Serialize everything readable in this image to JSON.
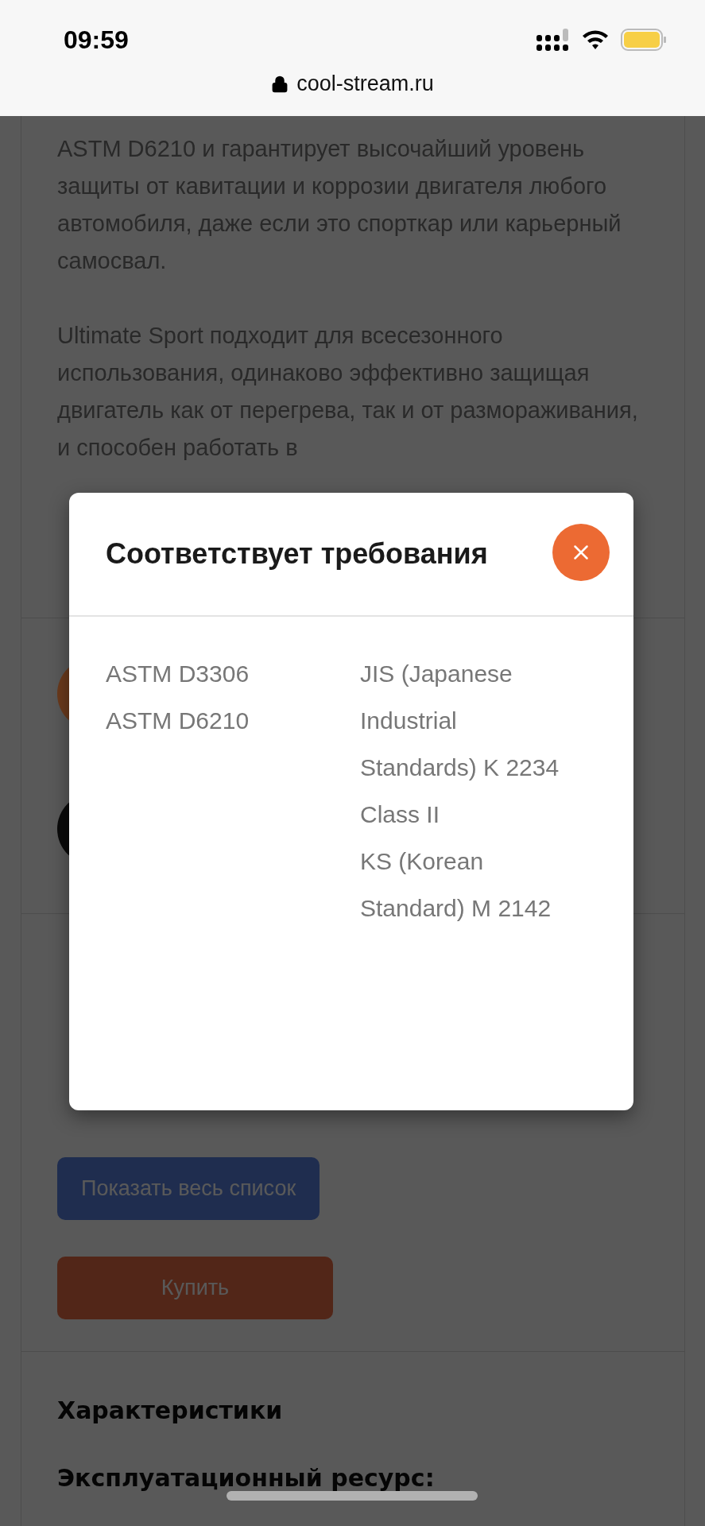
{
  "status_bar": {
    "time": "09:59"
  },
  "address_bar": {
    "url": "cool-stream.ru"
  },
  "description": {
    "paragraphs": [
      "ASTM D6210 и гарантирует высочайший уровень защиты от кавитации и коррозии двигателя любого автомобиля, даже если это спорткар или карьерный самосвал.",
      "Ultimate Sport подходит для всесезонного использования, одинаково эффективно защищая двигатель как от перегрева, так и от размораживания, и способен работать в"
    ]
  },
  "badges": [
    {
      "color": "#6b3a1c"
    },
    {
      "color": "#0a0a0a"
    }
  ],
  "actions": [
    {
      "label": "Показать весь список",
      "kind": "secondary"
    },
    {
      "label": "Купить",
      "kind": "primary"
    }
  ],
  "characteristics": {
    "title": "Характеристики",
    "subtitle": "Эксплуатационный ресурс:"
  },
  "modal": {
    "title": "Соответствует требования",
    "columns": [
      [
        "ASTM D3306",
        "ASTM D6210"
      ],
      [
        "JIS (Japanese Industrial Standards) K 2234 Class II",
        "KS (Korean Standard) M 2142"
      ]
    ]
  }
}
